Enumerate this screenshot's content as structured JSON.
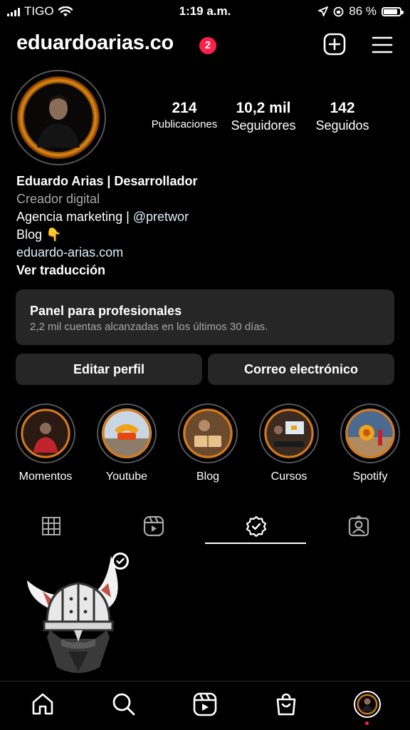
{
  "status_bar": {
    "carrier": "TIGO",
    "time": "1:19 a.m.",
    "battery": "86 %"
  },
  "header": {
    "username": "eduardoarias.co",
    "notification_count": "2"
  },
  "stats": [
    {
      "value": "214",
      "label": "Publicaciones"
    },
    {
      "value": "10,2 mil",
      "label": "Seguidores"
    },
    {
      "value": "142",
      "label": "Seguidos"
    }
  ],
  "bio": {
    "name": "Eduardo Arias | Desarrollador",
    "category": "Creador digital",
    "line1_text": "Agencia marketing | ",
    "line1_mention": "@pretwor",
    "line2": "Blog 👇",
    "link": "eduardo-arias.com",
    "translate": "Ver traducción"
  },
  "dashboard": {
    "title": "Panel para profesionales",
    "subtitle": "2,2 mil cuentas alcanzadas en los últimos 30 días."
  },
  "buttons": {
    "edit_profile": "Editar perfil",
    "email": "Correo electrónico"
  },
  "highlights": [
    {
      "label": "Momentos"
    },
    {
      "label": "Youtube"
    },
    {
      "label": "Blog"
    },
    {
      "label": "Cursos"
    },
    {
      "label": "Spotify"
    }
  ],
  "tabs": [
    {
      "icon": "grid-icon"
    },
    {
      "icon": "reels-icon"
    },
    {
      "icon": "verified-check-icon",
      "active": true
    },
    {
      "icon": "tagged-icon"
    }
  ],
  "bottom_nav": [
    {
      "icon": "home-icon"
    },
    {
      "icon": "search-icon"
    },
    {
      "icon": "reels-icon"
    },
    {
      "icon": "shop-icon"
    },
    {
      "icon": "profile-avatar"
    }
  ],
  "colors": {
    "background": "#000000",
    "surface": "#262626",
    "notification": "#ff1f4b",
    "secondary_text": "#a8a8a8",
    "link": "#e0f1ff"
  }
}
